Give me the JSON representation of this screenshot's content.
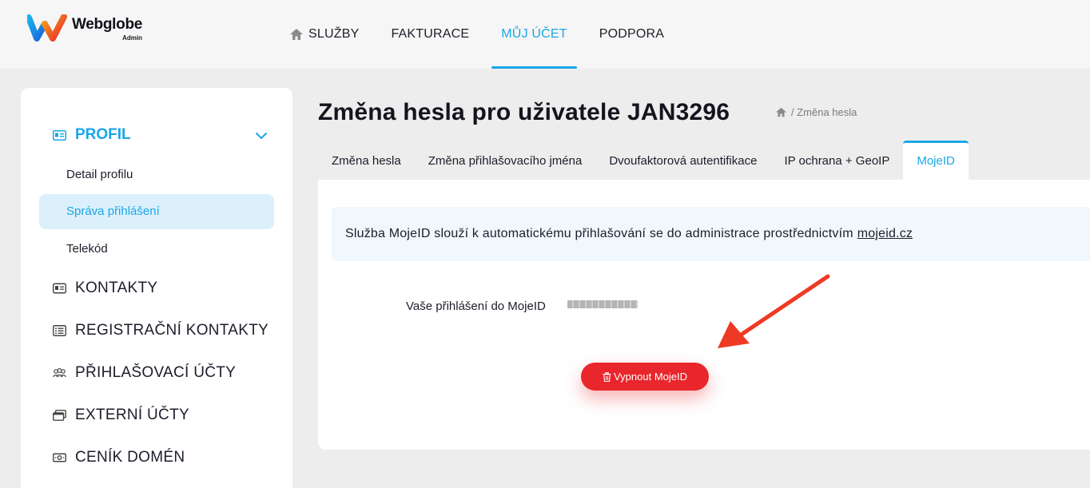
{
  "header": {
    "brand": "Webglobe",
    "brand_sub": "Admin",
    "nav": [
      {
        "label": "SLUŽBY"
      },
      {
        "label": "FAKTURACE"
      },
      {
        "label": "MŮJ ÚČET"
      },
      {
        "label": "PODPORA"
      }
    ],
    "active_nav": "MŮJ ÚČET"
  },
  "sidebar": {
    "section": "PROFIL",
    "subitems": [
      {
        "label": "Detail profilu"
      },
      {
        "label": "Správa přihlášení"
      },
      {
        "label": "Telekód"
      }
    ],
    "active_subitem": "Správa přihlášení",
    "items": [
      {
        "label": "KONTAKTY",
        "icon": "contact-card-icon"
      },
      {
        "label": "REGISTRAČNÍ KONTAKTY",
        "icon": "list-icon"
      },
      {
        "label": "PŘIHLAŠOVACÍ ÚČTY",
        "icon": "users-icon"
      },
      {
        "label": "EXTERNÍ ÚČTY",
        "icon": "windows-icon"
      },
      {
        "label": "CENÍK DOMÉN",
        "icon": "money-icon"
      }
    ]
  },
  "main": {
    "title": "Změna hesla pro uživatele JAN3296",
    "breadcrumb": "/ Změna hesla",
    "tabs": [
      {
        "label": "Změna hesla"
      },
      {
        "label": "Změna přihlašovacího jména"
      },
      {
        "label": "Dvoufaktorová autentifikace"
      },
      {
        "label": "IP ochrana + GeoIP"
      },
      {
        "label": "MojeID"
      }
    ],
    "active_tab": "MojeID",
    "info_text": "Služba MojeID slouží k automatickému přihlašování se do administrace prostřednictvím",
    "info_link": "mojeid.cz",
    "login_label": "Vaše přihlášení do MojeID",
    "button_label": "Vypnout MojeID"
  },
  "colors": {
    "accent": "#1aa7e6",
    "danger": "#e8262b",
    "annotation_arrow": "#ee3a24"
  }
}
